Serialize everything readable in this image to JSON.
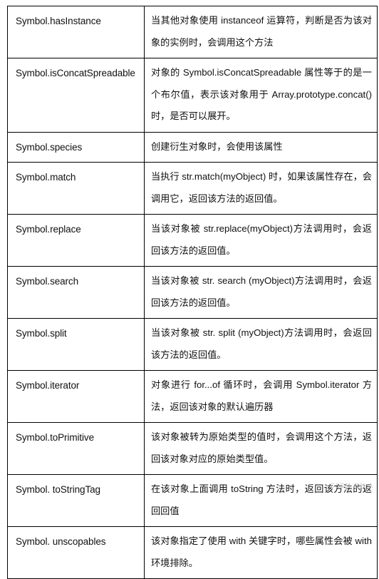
{
  "document": {
    "type": "reference-table",
    "table": {
      "columns": [
        "symbol-name",
        "description"
      ],
      "rows": [
        {
          "name": "Symbol.hasInstance",
          "description": "当其他对象使用 instanceof 运算符，判断是否为该对象的实例时，会调用这个方法"
        },
        {
          "name": "Symbol.isConcatSpreadable",
          "description": "对象的 Symbol.isConcatSpreadable 属性等于的是一个布尔值，表示该对象用于 Array.prototype.concat()时，是否可以展开。"
        },
        {
          "name": "Symbol.species",
          "description": "创建衍生对象时，会使用该属性"
        },
        {
          "name": "Symbol.match",
          "description": "当执行 str.match(myObject) 时，如果该属性存在，会调用它，返回该方法的返回值。"
        },
        {
          "name": "Symbol.replace",
          "description": "当该对象被 str.replace(myObject)方法调用时，会返回该方法的返回值。"
        },
        {
          "name": "Symbol.search",
          "description": "当该对象被 str. search (myObject)方法调用时，会返回该方法的返回值。"
        },
        {
          "name": "Symbol.split",
          "description": "当该对象被 str. split (myObject)方法调用时，会返回该方法的返回值。"
        },
        {
          "name": "Symbol.iterator",
          "description": "对象进行 for...of 循环时，会调用 Symbol.iterator 方法，返回该对象的默认遍历器"
        },
        {
          "name": "Symbol.toPrimitive",
          "description": "该对象被转为原始类型的值时，会调用这个方法，返回该对象对应的原始类型值。"
        },
        {
          "name": "Symbol. toStringTag",
          "description": "在该对象上面调用 toString 方法时，返回该方法的返回回值"
        },
        {
          "name": "Symbol. unscopables",
          "description": "该对象指定了使用 with 关键字时，哪些属性会被 with 环境排除。"
        }
      ]
    },
    "watermark": "CSDN @N-A",
    "colors": {
      "border": "#000000",
      "text": "#111111",
      "background": "#ffffff",
      "watermark": "#c9c9c9"
    }
  }
}
